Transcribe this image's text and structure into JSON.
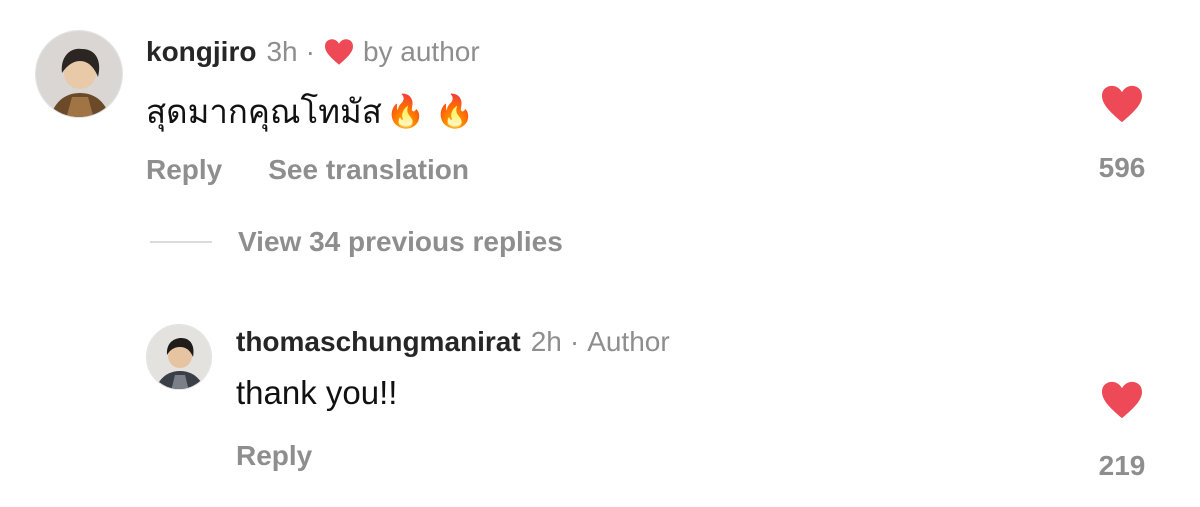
{
  "comments": [
    {
      "username": "kongjiro",
      "time": "3h",
      "separator": "·",
      "liked_by_label": "by author",
      "text": "สุดมากคุณโทมัส",
      "emojis": "🔥 🔥",
      "actions": {
        "reply": "Reply",
        "translate": "See translation"
      },
      "like_count": "596",
      "heart_color": "#ed4956"
    },
    {
      "username": "thomaschungmanirat",
      "time": "2h",
      "separator": "·",
      "author_label": "Author",
      "text": "thank you!!",
      "actions": {
        "reply": "Reply"
      },
      "like_count": "219",
      "heart_color": "#ed4956"
    }
  ],
  "view_replies_label": "View 34 previous replies",
  "icons": {
    "heart": "heart-filled-icon",
    "small_heart": "heart-small-icon"
  }
}
